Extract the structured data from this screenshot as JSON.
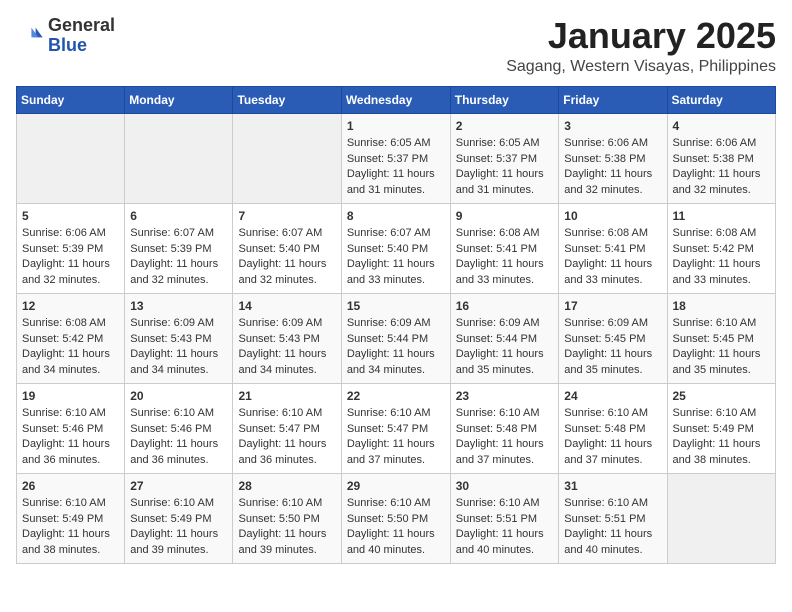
{
  "logo": {
    "general": "General",
    "blue": "Blue"
  },
  "header": {
    "month": "January 2025",
    "location": "Sagang, Western Visayas, Philippines"
  },
  "weekdays": [
    "Sunday",
    "Monday",
    "Tuesday",
    "Wednesday",
    "Thursday",
    "Friday",
    "Saturday"
  ],
  "weeks": [
    [
      {
        "day": "",
        "sunrise": "",
        "sunset": "",
        "daylight": ""
      },
      {
        "day": "",
        "sunrise": "",
        "sunset": "",
        "daylight": ""
      },
      {
        "day": "",
        "sunrise": "",
        "sunset": "",
        "daylight": ""
      },
      {
        "day": "1",
        "sunrise": "Sunrise: 6:05 AM",
        "sunset": "Sunset: 5:37 PM",
        "daylight": "Daylight: 11 hours and 31 minutes."
      },
      {
        "day": "2",
        "sunrise": "Sunrise: 6:05 AM",
        "sunset": "Sunset: 5:37 PM",
        "daylight": "Daylight: 11 hours and 31 minutes."
      },
      {
        "day": "3",
        "sunrise": "Sunrise: 6:06 AM",
        "sunset": "Sunset: 5:38 PM",
        "daylight": "Daylight: 11 hours and 32 minutes."
      },
      {
        "day": "4",
        "sunrise": "Sunrise: 6:06 AM",
        "sunset": "Sunset: 5:38 PM",
        "daylight": "Daylight: 11 hours and 32 minutes."
      }
    ],
    [
      {
        "day": "5",
        "sunrise": "Sunrise: 6:06 AM",
        "sunset": "Sunset: 5:39 PM",
        "daylight": "Daylight: 11 hours and 32 minutes."
      },
      {
        "day": "6",
        "sunrise": "Sunrise: 6:07 AM",
        "sunset": "Sunset: 5:39 PM",
        "daylight": "Daylight: 11 hours and 32 minutes."
      },
      {
        "day": "7",
        "sunrise": "Sunrise: 6:07 AM",
        "sunset": "Sunset: 5:40 PM",
        "daylight": "Daylight: 11 hours and 32 minutes."
      },
      {
        "day": "8",
        "sunrise": "Sunrise: 6:07 AM",
        "sunset": "Sunset: 5:40 PM",
        "daylight": "Daylight: 11 hours and 33 minutes."
      },
      {
        "day": "9",
        "sunrise": "Sunrise: 6:08 AM",
        "sunset": "Sunset: 5:41 PM",
        "daylight": "Daylight: 11 hours and 33 minutes."
      },
      {
        "day": "10",
        "sunrise": "Sunrise: 6:08 AM",
        "sunset": "Sunset: 5:41 PM",
        "daylight": "Daylight: 11 hours and 33 minutes."
      },
      {
        "day": "11",
        "sunrise": "Sunrise: 6:08 AM",
        "sunset": "Sunset: 5:42 PM",
        "daylight": "Daylight: 11 hours and 33 minutes."
      }
    ],
    [
      {
        "day": "12",
        "sunrise": "Sunrise: 6:08 AM",
        "sunset": "Sunset: 5:42 PM",
        "daylight": "Daylight: 11 hours and 34 minutes."
      },
      {
        "day": "13",
        "sunrise": "Sunrise: 6:09 AM",
        "sunset": "Sunset: 5:43 PM",
        "daylight": "Daylight: 11 hours and 34 minutes."
      },
      {
        "day": "14",
        "sunrise": "Sunrise: 6:09 AM",
        "sunset": "Sunset: 5:43 PM",
        "daylight": "Daylight: 11 hours and 34 minutes."
      },
      {
        "day": "15",
        "sunrise": "Sunrise: 6:09 AM",
        "sunset": "Sunset: 5:44 PM",
        "daylight": "Daylight: 11 hours and 34 minutes."
      },
      {
        "day": "16",
        "sunrise": "Sunrise: 6:09 AM",
        "sunset": "Sunset: 5:44 PM",
        "daylight": "Daylight: 11 hours and 35 minutes."
      },
      {
        "day": "17",
        "sunrise": "Sunrise: 6:09 AM",
        "sunset": "Sunset: 5:45 PM",
        "daylight": "Daylight: 11 hours and 35 minutes."
      },
      {
        "day": "18",
        "sunrise": "Sunrise: 6:10 AM",
        "sunset": "Sunset: 5:45 PM",
        "daylight": "Daylight: 11 hours and 35 minutes."
      }
    ],
    [
      {
        "day": "19",
        "sunrise": "Sunrise: 6:10 AM",
        "sunset": "Sunset: 5:46 PM",
        "daylight": "Daylight: 11 hours and 36 minutes."
      },
      {
        "day": "20",
        "sunrise": "Sunrise: 6:10 AM",
        "sunset": "Sunset: 5:46 PM",
        "daylight": "Daylight: 11 hours and 36 minutes."
      },
      {
        "day": "21",
        "sunrise": "Sunrise: 6:10 AM",
        "sunset": "Sunset: 5:47 PM",
        "daylight": "Daylight: 11 hours and 36 minutes."
      },
      {
        "day": "22",
        "sunrise": "Sunrise: 6:10 AM",
        "sunset": "Sunset: 5:47 PM",
        "daylight": "Daylight: 11 hours and 37 minutes."
      },
      {
        "day": "23",
        "sunrise": "Sunrise: 6:10 AM",
        "sunset": "Sunset: 5:48 PM",
        "daylight": "Daylight: 11 hours and 37 minutes."
      },
      {
        "day": "24",
        "sunrise": "Sunrise: 6:10 AM",
        "sunset": "Sunset: 5:48 PM",
        "daylight": "Daylight: 11 hours and 37 minutes."
      },
      {
        "day": "25",
        "sunrise": "Sunrise: 6:10 AM",
        "sunset": "Sunset: 5:49 PM",
        "daylight": "Daylight: 11 hours and 38 minutes."
      }
    ],
    [
      {
        "day": "26",
        "sunrise": "Sunrise: 6:10 AM",
        "sunset": "Sunset: 5:49 PM",
        "daylight": "Daylight: 11 hours and 38 minutes."
      },
      {
        "day": "27",
        "sunrise": "Sunrise: 6:10 AM",
        "sunset": "Sunset: 5:49 PM",
        "daylight": "Daylight: 11 hours and 39 minutes."
      },
      {
        "day": "28",
        "sunrise": "Sunrise: 6:10 AM",
        "sunset": "Sunset: 5:50 PM",
        "daylight": "Daylight: 11 hours and 39 minutes."
      },
      {
        "day": "29",
        "sunrise": "Sunrise: 6:10 AM",
        "sunset": "Sunset: 5:50 PM",
        "daylight": "Daylight: 11 hours and 40 minutes."
      },
      {
        "day": "30",
        "sunrise": "Sunrise: 6:10 AM",
        "sunset": "Sunset: 5:51 PM",
        "daylight": "Daylight: 11 hours and 40 minutes."
      },
      {
        "day": "31",
        "sunrise": "Sunrise: 6:10 AM",
        "sunset": "Sunset: 5:51 PM",
        "daylight": "Daylight: 11 hours and 40 minutes."
      },
      {
        "day": "",
        "sunrise": "",
        "sunset": "",
        "daylight": ""
      }
    ]
  ]
}
